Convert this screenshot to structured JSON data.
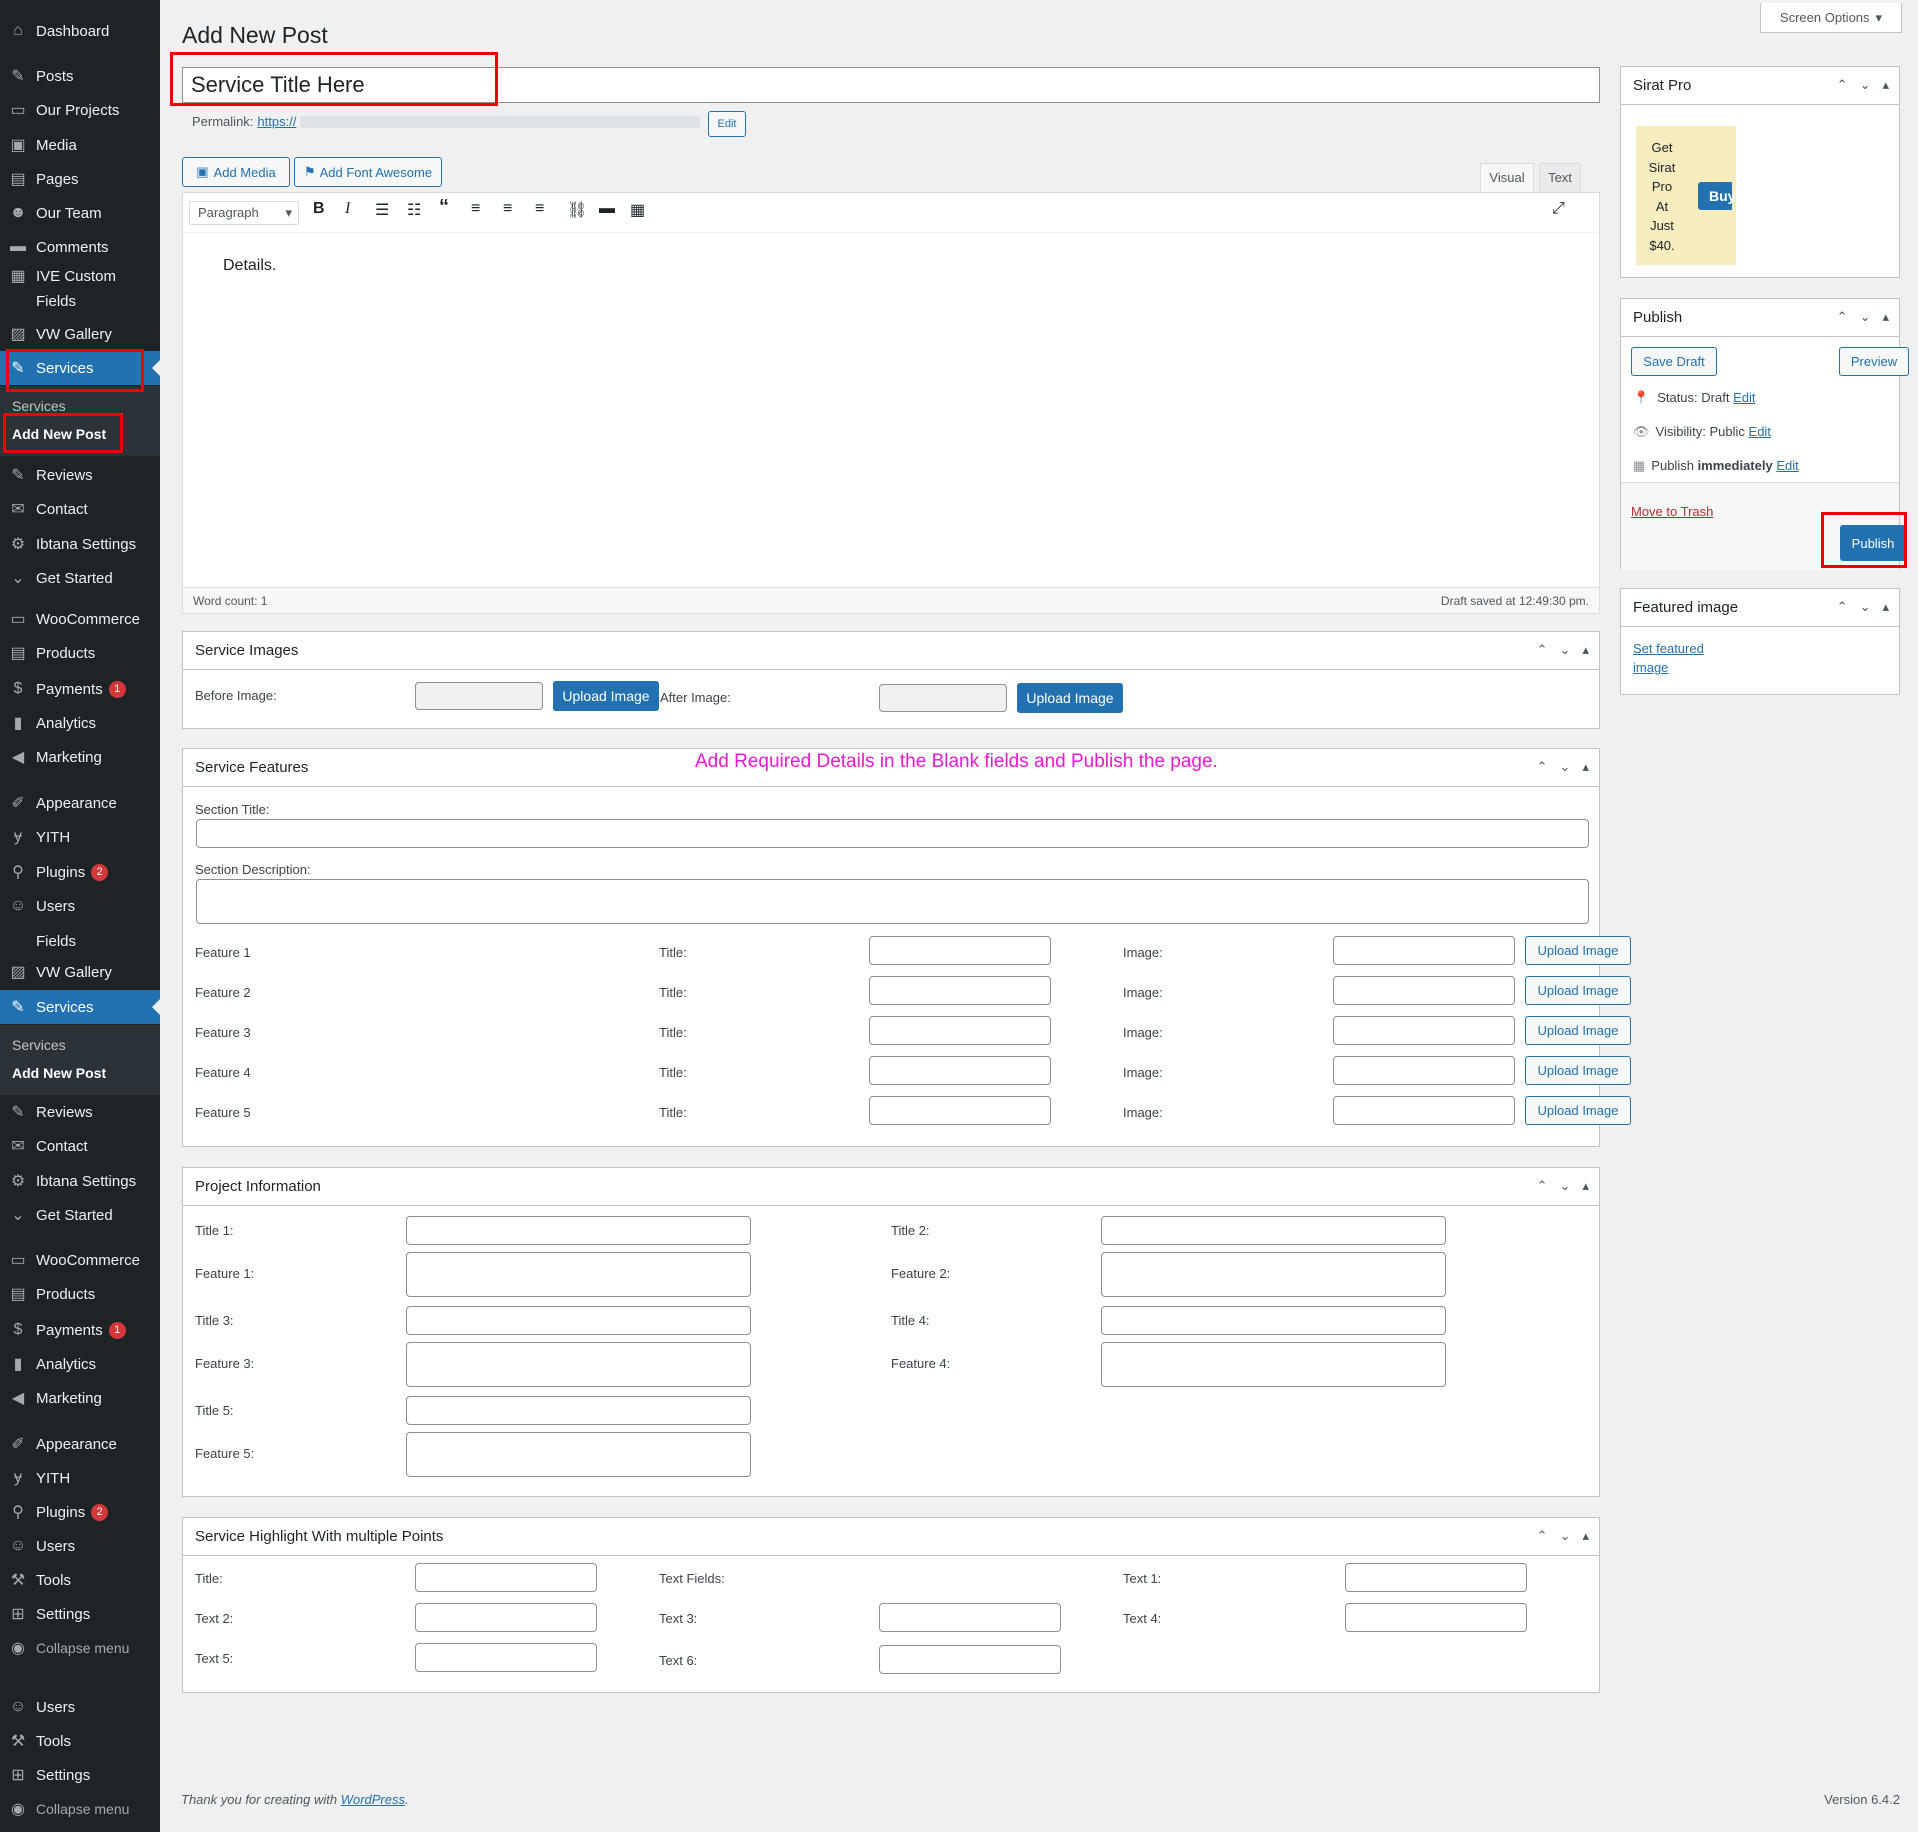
{
  "menu": {
    "top": [
      {
        "label": "Dashboard",
        "icon": "dashboard-icon"
      },
      {
        "label": "Posts",
        "icon": "pin-icon"
      },
      {
        "label": "Our Projects",
        "icon": "folder-icon"
      },
      {
        "label": "Media",
        "icon": "media-icon"
      },
      {
        "label": "Pages",
        "icon": "pages-icon"
      },
      {
        "label": "Our Team",
        "icon": "team-icon"
      },
      {
        "label": "Comments",
        "icon": "comments-icon"
      },
      {
        "label": "IVE Custom",
        "icon": "fields-icon"
      },
      {
        "label": "Fields"
      },
      {
        "label": "VW Gallery",
        "icon": "gallery-icon"
      },
      {
        "label": "Services",
        "icon": "pin-icon"
      }
    ],
    "services_sub": [
      "Services",
      "Add New Post"
    ],
    "mid": [
      {
        "label": "Reviews"
      },
      {
        "label": "Contact"
      },
      {
        "label": "Ibtana Settings"
      },
      {
        "label": "Get Started"
      },
      {
        "label": "WooCommerce"
      },
      {
        "label": "Products"
      },
      {
        "label": "Payments",
        "badge": "1"
      },
      {
        "label": "Analytics"
      },
      {
        "label": "Marketing"
      },
      {
        "label": "Appearance"
      },
      {
        "label": "YITH"
      },
      {
        "label": "Plugins",
        "badge": "2"
      },
      {
        "label": "Users"
      },
      {
        "label": "Fields"
      },
      {
        "label": "VW Gallery"
      },
      {
        "label": "Services"
      }
    ],
    "mid_sub": [
      "Services",
      "Add New Post"
    ],
    "low": [
      {
        "label": "Reviews"
      },
      {
        "label": "Contact"
      },
      {
        "label": "Ibtana Settings"
      },
      {
        "label": "Get Started"
      },
      {
        "label": "WooCommerce"
      },
      {
        "label": "Products"
      },
      {
        "label": "Payments",
        "badge": "1"
      },
      {
        "label": "Analytics"
      },
      {
        "label": "Marketing"
      },
      {
        "label": "Appearance"
      },
      {
        "label": "YITH"
      },
      {
        "label": "Plugins",
        "badge": "2"
      },
      {
        "label": "Users"
      },
      {
        "label": "Tools"
      },
      {
        "label": "Settings"
      },
      {
        "label": "Collapse menu"
      },
      {
        "label": "Users"
      },
      {
        "label": "Tools"
      },
      {
        "label": "Settings"
      },
      {
        "label": "Collapse menu"
      }
    ]
  },
  "page": {
    "title": "Add New Post",
    "screen_options": "Screen Options",
    "post_title": "Service Title Here",
    "permalink_label": "Permalink:",
    "permalink_url": "https://",
    "edit": "Edit"
  },
  "editor": {
    "add_media": "Add Media",
    "add_font_awesome": "Add Font Awesome",
    "tab_visual": "Visual",
    "tab_text": "Text",
    "format": "Paragraph",
    "content": "Details.",
    "word_count": "Word count: 1",
    "draft_saved": "Draft saved at 12:49:30 pm."
  },
  "service_images": {
    "title": "Service Images",
    "before": "Before Image:",
    "after": "After Image:",
    "upload": "Upload Image"
  },
  "features": {
    "title": "Service Features",
    "note": "Add Required Details in the Blank fields and Publish the page.",
    "section_title": "Section Title:",
    "section_desc": "Section Description:",
    "rows": [
      "Feature 1",
      "Feature 2",
      "Feature 3",
      "Feature 4",
      "Feature 5"
    ],
    "title_lbl": "Title:",
    "image_lbl": "Image:",
    "upload": "Upload Image"
  },
  "project": {
    "title": "Project Information",
    "left": [
      "Title 1:",
      "Feature 1:",
      "Title 3:",
      "Feature 3:",
      "Title 5:",
      "Feature 5:"
    ],
    "right": [
      "Title 2:",
      "Feature 2:",
      "Title 4:",
      "Feature 4:"
    ]
  },
  "highlight": {
    "title": "Service Highlight With multiple Points",
    "labels": [
      "Title:",
      "Text Fields:",
      "Text 1:",
      "Text 2:",
      "Text 3:",
      "Text 4:",
      "Text 5:",
      "Text 6:"
    ]
  },
  "sirat": {
    "title": "Sirat Pro",
    "promo": [
      "Get",
      "Sirat",
      "Pro",
      "At",
      "Just",
      "$40."
    ],
    "buy": "Buy"
  },
  "publish": {
    "title": "Publish",
    "save_draft": "Save Draft",
    "preview": "Preview",
    "status": "Status:",
    "status_val": "Draft",
    "visibility": "Visibility:",
    "visibility_val": "Public",
    "publish_lbl": "Publish",
    "publish_val": "immediately",
    "edit": "Edit",
    "trash": "Move to Trash",
    "publish_btn": "Publish"
  },
  "featured": {
    "title": "Featured image",
    "link1": "Set featured",
    "link2": "image"
  },
  "footer": {
    "thanks": "Thank you for creating with",
    "wp": "WordPress",
    "version": "Version 6.4.2"
  }
}
